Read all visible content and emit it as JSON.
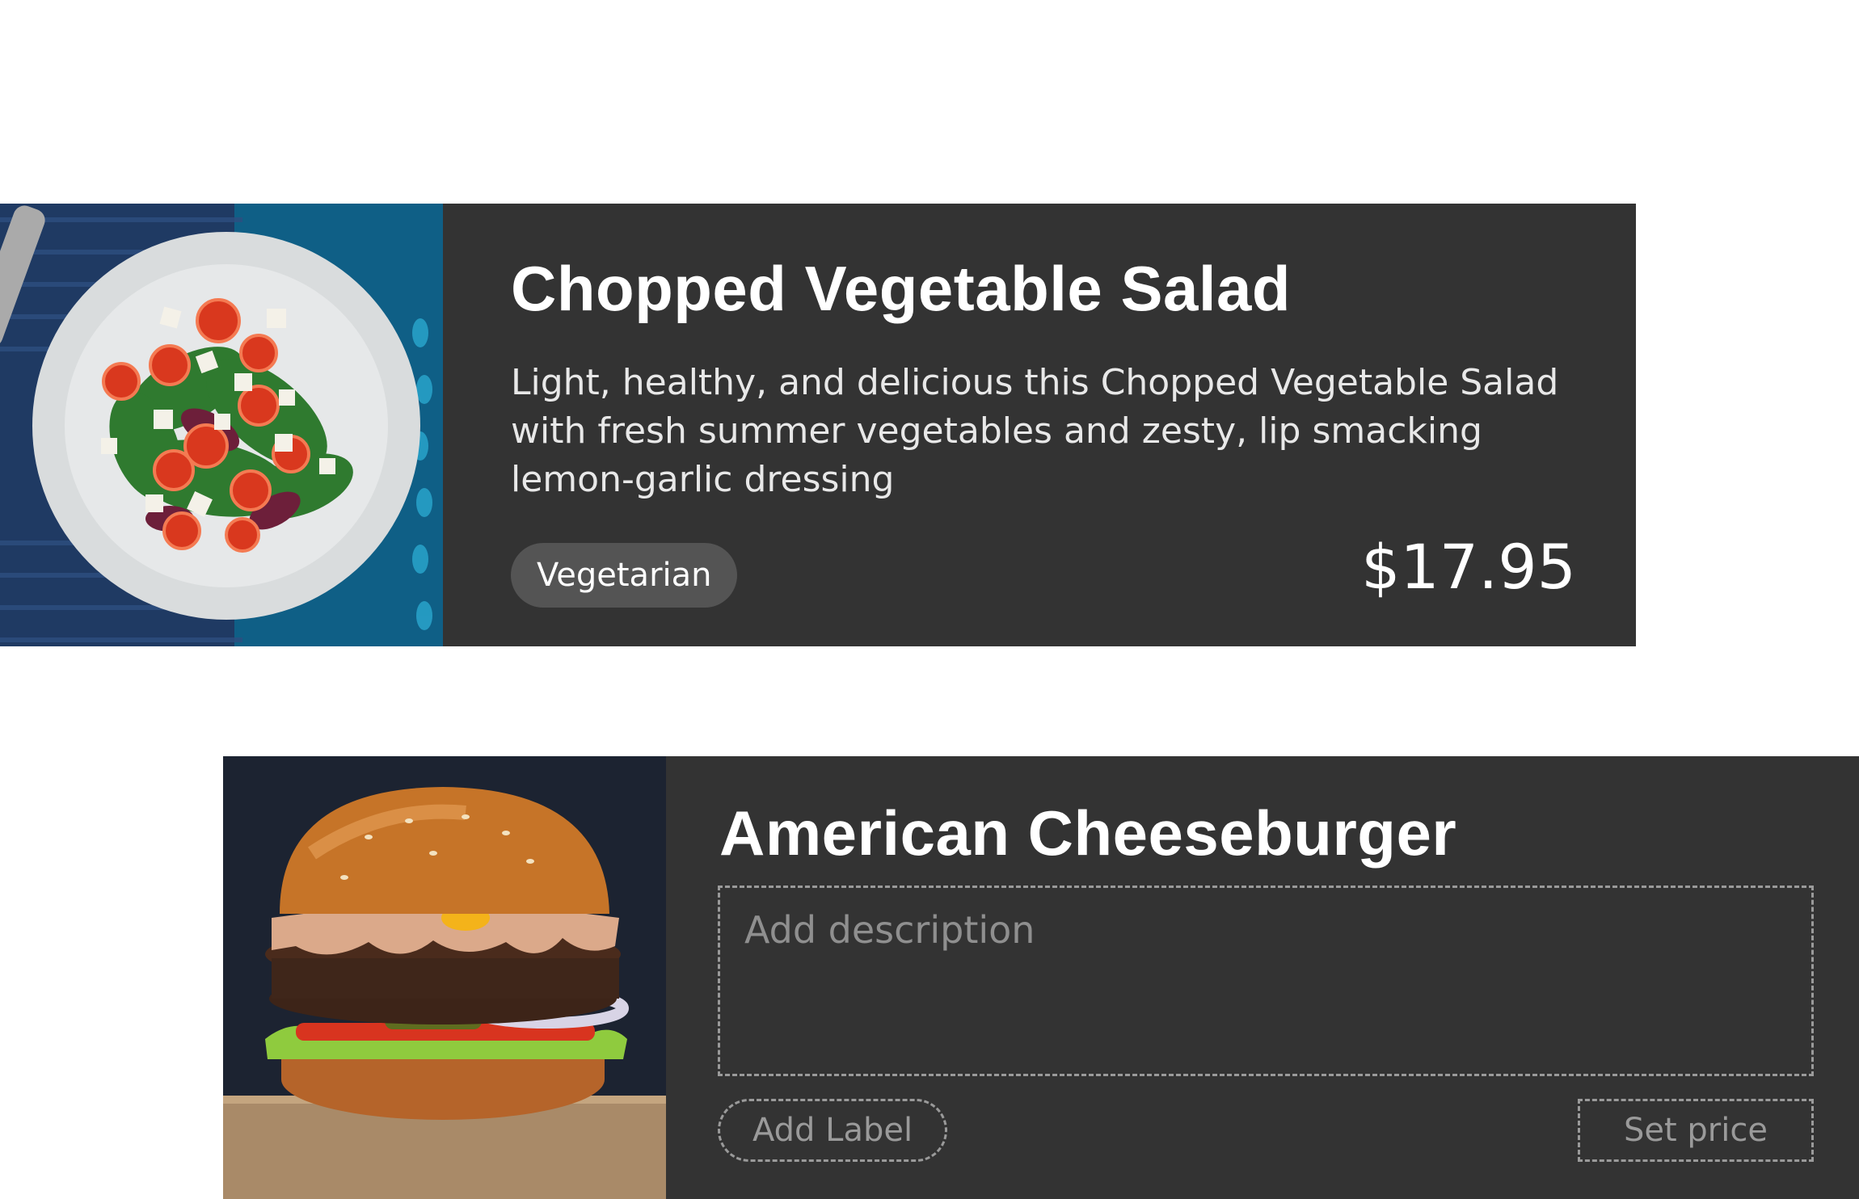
{
  "cards": [
    {
      "title": "Chopped Vegetable Salad",
      "description": "Light, healthy, and delicious this Chopped Vegetable Salad with fresh summer vegetables and zesty, lip smacking lemon-garlic dressing",
      "label": "Vegetarian",
      "price": "$17.95",
      "image": "salad-photo"
    },
    {
      "title": "American Cheeseburger",
      "description_placeholder": "Add description",
      "label_placeholder": "Add Label",
      "price_placeholder": "Set price",
      "image": "cheeseburger-photo"
    }
  ],
  "colors": {
    "card_background": "#333333",
    "tag_background": "#545454",
    "placeholder_border": "#9a9a9a",
    "text": "#ffffff"
  }
}
